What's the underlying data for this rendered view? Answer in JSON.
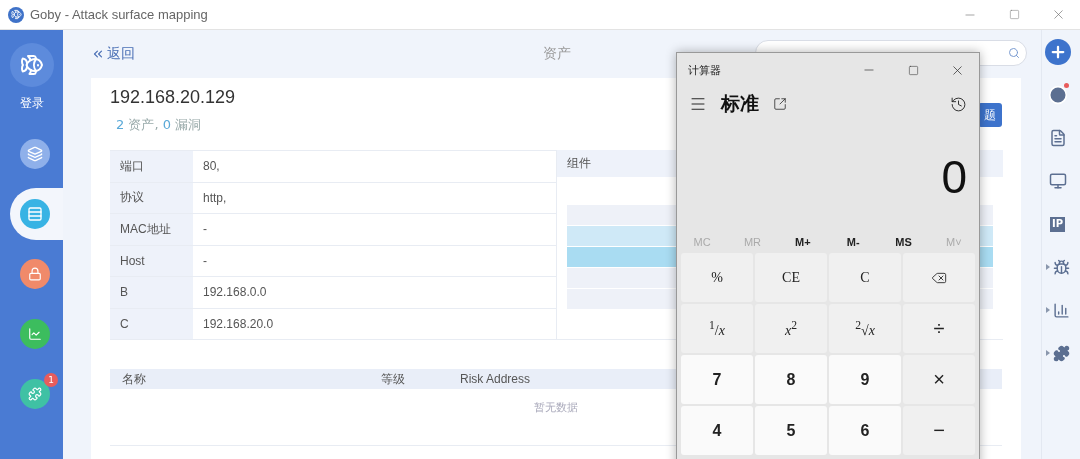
{
  "window": {
    "title": "Goby - Attack surface mapping"
  },
  "sidebar": {
    "login_label": "登录",
    "items": [
      {
        "kind": "scan",
        "selected": false
      },
      {
        "kind": "assets",
        "selected": true
      },
      {
        "kind": "vulns",
        "selected": false
      },
      {
        "kind": "stats",
        "selected": false
      },
      {
        "kind": "plugins",
        "selected": false,
        "badge": "1"
      }
    ]
  },
  "header": {
    "back": "返回",
    "title": "资产"
  },
  "asset": {
    "ip": "192.168.20.129",
    "asset_count": "2",
    "asset_label": "资产,",
    "vuln_count": "0",
    "vuln_label": "漏洞"
  },
  "issue_button": {
    "label": "题"
  },
  "info_rows": [
    {
      "label": "端口",
      "value": "80,"
    },
    {
      "label": "协议",
      "value": "http,"
    },
    {
      "label": "MAC地址",
      "value": "-"
    },
    {
      "label": "Host",
      "value": "-"
    },
    {
      "label": "B",
      "value": "192.168.0.0"
    },
    {
      "label": "C",
      "value": "192.168.20.0"
    }
  ],
  "components": {
    "title": "组件"
  },
  "vuln_table": {
    "columns": [
      "名称",
      "等级",
      "Risk Address"
    ],
    "empty": "暂无数据"
  },
  "right_bar": {
    "items": [
      {
        "kind": "add",
        "expandable": false
      },
      {
        "kind": "history",
        "expandable": false,
        "dot": true
      },
      {
        "kind": "document",
        "expandable": false
      },
      {
        "kind": "monitor",
        "expandable": false
      },
      {
        "kind": "ip",
        "expandable": false,
        "label": "IP"
      },
      {
        "kind": "bug",
        "expandable": true
      },
      {
        "kind": "chart",
        "expandable": true
      },
      {
        "kind": "puzzle",
        "expandable": true
      }
    ]
  },
  "calculator": {
    "title": "计算器",
    "mode": "标准",
    "display": "0",
    "memory": [
      {
        "label": "MC",
        "disabled": true
      },
      {
        "label": "MR",
        "disabled": true
      },
      {
        "label": "M+",
        "disabled": false
      },
      {
        "label": "M-",
        "disabled": false
      },
      {
        "label": "MS",
        "disabled": false
      },
      {
        "label": "M˅",
        "disabled": true
      }
    ],
    "keys": [
      {
        "label": "%",
        "kind": "function"
      },
      {
        "label": "CE",
        "kind": "function"
      },
      {
        "label": "C",
        "kind": "function"
      },
      {
        "kind": "backspace"
      },
      {
        "label": "$^{1}$/*x*",
        "kind": "function"
      },
      {
        "label": "*x*$^{2}$",
        "kind": "function"
      },
      {
        "label": "$^{2}$√*x*",
        "kind": "function"
      },
      {
        "label": "÷",
        "kind": "operator"
      },
      {
        "label": "7",
        "kind": "digit"
      },
      {
        "label": "8",
        "kind": "digit"
      },
      {
        "label": "9",
        "kind": "digit"
      },
      {
        "label": "×",
        "kind": "operator"
      },
      {
        "label": "4",
        "kind": "digit"
      },
      {
        "label": "5",
        "kind": "digit"
      },
      {
        "label": "6",
        "kind": "digit"
      },
      {
        "label": "−",
        "kind": "operator"
      }
    ]
  }
}
